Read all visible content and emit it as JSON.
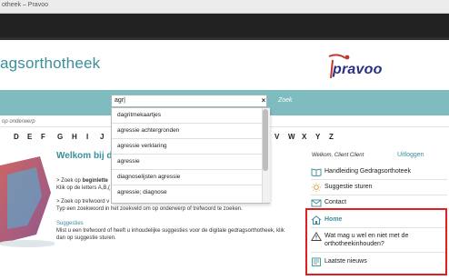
{
  "browser": {
    "tab_title": "otheek – Pravoo"
  },
  "header": {
    "site_title_prefix": "agsorthotheek",
    "logo_text": "pravoo"
  },
  "search": {
    "value": "agr|",
    "clear_label": "×",
    "button_label": "Zoek",
    "suggestions": [
      "dagritmekaartjes",
      "agressie achtergronden",
      "agressie verklaring",
      "agressie",
      "diagnoselijsten agressie",
      "agressie; diagnose"
    ]
  },
  "subrow": {
    "label": "op onderwerp"
  },
  "letters": [
    "D",
    "E",
    "F",
    "G",
    "H",
    "I",
    "J",
    "V",
    "W",
    "X",
    "Y",
    "Z"
  ],
  "main": {
    "welcome_title": "Welkom bij de d",
    "line1_prefix": "> Zoek op ",
    "line1_bold": "beginlette",
    "line2": "Klik op de letters A,B,(",
    "line3": "> Zoek op trefwoord v",
    "line4": "Typ een zoekwoord in het zoekveld om op onderwerp of trefwoord te zoeken.",
    "suggestions_heading": "Suggesties",
    "suggestions_text1": "Mist u een trefwoord of heeft u inhoudelijke suggesties voor de digitale gedragsorthotheek, klik",
    "suggestions_text2": "dan op suggestie sturen."
  },
  "sidebar": {
    "welcome": "Welkom, Client Client",
    "logout": "Uitloggen",
    "items": [
      {
        "label": "Handleiding Gedragsorthoteek",
        "icon": "book-icon"
      },
      {
        "label": "Suggestie sturen",
        "icon": "lightbulb-icon"
      },
      {
        "label": "Contact",
        "icon": "envelope-icon"
      },
      {
        "label": "Home",
        "icon": "home-icon"
      },
      {
        "label": "Wat mag u wel en niet met de",
        "label2": "orthotheekinhouden?",
        "icon": "warning-icon"
      },
      {
        "label": "Laatste nieuws",
        "icon": "news-icon"
      }
    ]
  },
  "colors": {
    "accent": "#3a8f9a",
    "search_band": "#7fbcc0",
    "logo": "#2a2f86",
    "highlight": "#e02020"
  }
}
